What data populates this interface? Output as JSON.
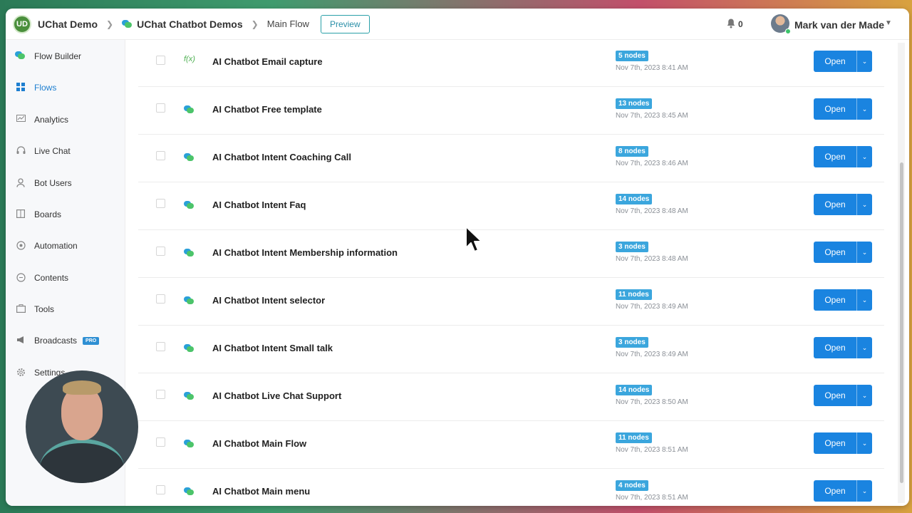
{
  "header": {
    "workspace_initials": "UD",
    "workspace_name": "UChat Demo",
    "bot_name": "UChat Chatbot Demos",
    "flow_name": "Main Flow",
    "preview_label": "Preview",
    "notification_count": "0",
    "user_name": "Mark van der Made"
  },
  "sidebar": {
    "items": [
      {
        "label": "Flow Builder",
        "icon": "chat-bubbles-icon"
      },
      {
        "label": "Flows",
        "icon": "grid-icon",
        "active": true
      },
      {
        "label": "Analytics",
        "icon": "chart-icon"
      },
      {
        "label": "Live Chat",
        "icon": "headset-icon"
      },
      {
        "label": "Bot Users",
        "icon": "user-icon"
      },
      {
        "label": "Boards",
        "icon": "board-icon"
      },
      {
        "label": "Automation",
        "icon": "automation-icon"
      },
      {
        "label": "Contents",
        "icon": "contents-icon"
      },
      {
        "label": "Tools",
        "icon": "tools-icon"
      },
      {
        "label": "Broadcasts",
        "icon": "megaphone-icon",
        "badge": "PRO"
      },
      {
        "label": "Settings",
        "icon": "gear-icon"
      }
    ]
  },
  "flows": [
    {
      "name": "AI Chatbot Email capture",
      "nodes": "5 nodes",
      "date": "Nov 7th, 2023 8:41 AM",
      "type": "function"
    },
    {
      "name": "AI Chatbot Free template",
      "nodes": "13 nodes",
      "date": "Nov 7th, 2023 8:45 AM",
      "type": "chat"
    },
    {
      "name": "AI Chatbot Intent Coaching Call",
      "nodes": "8 nodes",
      "date": "Nov 7th, 2023 8:46 AM",
      "type": "chat"
    },
    {
      "name": "AI Chatbot Intent Faq",
      "nodes": "14 nodes",
      "date": "Nov 7th, 2023 8:48 AM",
      "type": "chat"
    },
    {
      "name": "AI Chatbot Intent Membership information",
      "nodes": "3 nodes",
      "date": "Nov 7th, 2023 8:48 AM",
      "type": "chat"
    },
    {
      "name": "AI Chatbot Intent selector",
      "nodes": "11 nodes",
      "date": "Nov 7th, 2023 8:49 AM",
      "type": "chat"
    },
    {
      "name": "AI Chatbot Intent Small talk",
      "nodes": "3 nodes",
      "date": "Nov 7th, 2023 8:49 AM",
      "type": "chat"
    },
    {
      "name": "AI Chatbot Live Chat Support",
      "nodes": "14 nodes",
      "date": "Nov 7th, 2023 8:50 AM",
      "type": "chat"
    },
    {
      "name": "AI Chatbot Main Flow",
      "nodes": "11 nodes",
      "date": "Nov 7th, 2023 8:51 AM",
      "type": "chat"
    },
    {
      "name": "AI Chatbot Main menu",
      "nodes": "4 nodes",
      "date": "Nov 7th, 2023 8:51 AM",
      "type": "chat"
    }
  ],
  "row_actions": {
    "open_label": "Open",
    "function_symbol": "f(x)"
  },
  "colors": {
    "primary": "#1a84e0",
    "badge": "#3ba6dd",
    "active_nav": "#1e7fd0"
  }
}
